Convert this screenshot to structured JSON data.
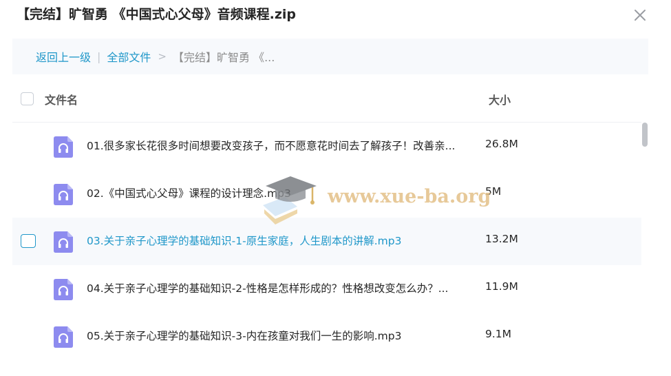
{
  "dialog": {
    "title": "【完结】旷智勇 《中国式心父母》音频课程.zip",
    "close_icon": "close-icon"
  },
  "breadcrumb": {
    "back_label": "返回上一级",
    "separator": "|",
    "root_label": "全部文件",
    "arrow": ">",
    "current_label": "【完结】旷智勇 《..."
  },
  "table": {
    "name_header": "文件名",
    "size_header": "大小"
  },
  "files": [
    {
      "name": "01.很多家长花很多时间想要改变孩子，而不愿意花时间去了解孩子！改善亲...",
      "size": "26.8M",
      "icon": "audio-file-icon"
    },
    {
      "name": "02.《中国式心父母》课程的设计理念.mp3",
      "size": "5M",
      "icon": "audio-file-icon"
    },
    {
      "name": "03.关于亲子心理学的基础知识-1-原生家庭，人生剧本的讲解.mp3",
      "size": "13.2M",
      "icon": "audio-file-icon"
    },
    {
      "name": "04.关于亲子心理学的基础知识-2-性格是怎样形成的？性格想改变怎么办？...",
      "size": "11.9M",
      "icon": "audio-file-icon"
    },
    {
      "name": "05.关于亲子心理学的基础知识-3-内在孩童对我们一生的影响.mp3",
      "size": "9.1M",
      "icon": "audio-file-icon"
    }
  ],
  "watermark": {
    "text": "www.xue-ba.org"
  },
  "colors": {
    "accent": "#1f97c9",
    "icon_purple": "#8d8bef",
    "text": "#262626"
  }
}
